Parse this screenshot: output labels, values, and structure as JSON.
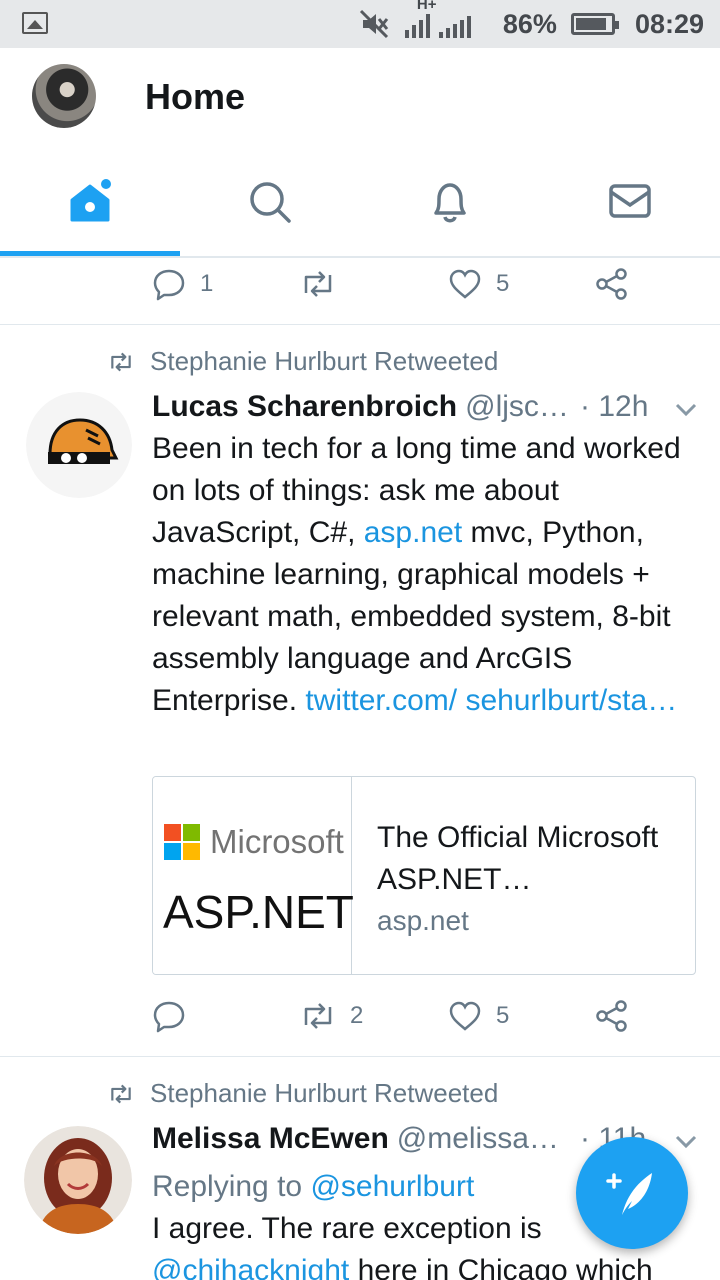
{
  "status_bar": {
    "network": "H+",
    "battery": "86%",
    "time": "08:29"
  },
  "header": {
    "title": "Home"
  },
  "tabs": [
    {
      "name": "home",
      "icon": "home-icon",
      "active": true
    },
    {
      "name": "search",
      "icon": "search-icon",
      "active": false
    },
    {
      "name": "notifications",
      "icon": "bell-icon",
      "active": false
    },
    {
      "name": "messages",
      "icon": "mail-icon",
      "active": false
    }
  ],
  "tweet0": {
    "reply_count": "1",
    "retweet_count": "",
    "like_count": "5"
  },
  "tweet1": {
    "retweeted_by": "Stephanie Hurlburt Retweeted",
    "author_name": "Lucas Scharenbroich",
    "author_handle": "@ljsc…",
    "time": "· 12h",
    "text_a": "Been in tech for a long time and worked on lots of things: ask me about JavaScript, C#, ",
    "text_link1": "asp.net",
    "text_b": " mvc, Python, machine learning, graphical models + relevant math, embedded system, 8-bit assembly language and ArcGIS Enterprise. ",
    "text_link2": "twitter.com/ sehurlburt/sta…",
    "card": {
      "logo_word": "Microsoft",
      "logo_product": "ASP.NET",
      "title": "The Official Microsoft ASP.NET…",
      "domain": "asp.net"
    },
    "reply_count": "",
    "retweet_count": "2",
    "like_count": "5"
  },
  "tweet2": {
    "retweeted_by": "Stephanie Hurlburt Retweeted",
    "author_name": "Melissa McEwen",
    "author_handle": "@melissa…",
    "time": "· 11h",
    "replying_prefix": "Replying to ",
    "replying_to": "@sehurlburt",
    "text_a": "I agree. The rare exception is",
    "text_link": "@chihacknight",
    "text_b": " here in Chicago which"
  },
  "colors": {
    "accent": "#1da1f2",
    "link": "#1b95e0",
    "muted": "#657786",
    "text": "#14171a"
  }
}
